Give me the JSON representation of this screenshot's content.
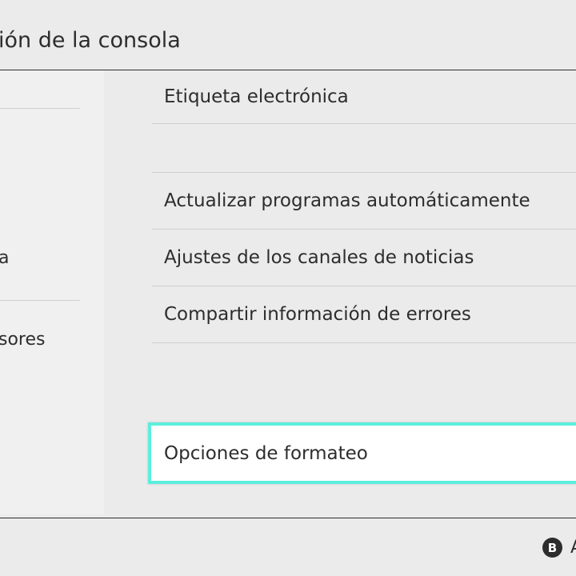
{
  "header": {
    "title": "ión de la consola"
  },
  "sidebar": {
    "items": [
      {
        "label": "a"
      },
      {
        "label": "sores"
      }
    ]
  },
  "menu": {
    "items": [
      {
        "label": "Etiqueta electrónica"
      },
      {
        "label": ""
      },
      {
        "label": "Actualizar programas automáticamente"
      },
      {
        "label": "Ajustes de los canales de noticias"
      },
      {
        "label": "Compartir información de errores"
      },
      {
        "label": "Opciones de formateo"
      }
    ]
  },
  "footer": {
    "button_icon": "B",
    "button_label": "A"
  },
  "colors": {
    "focus_border": "#5ceedc",
    "background": "#ebebeb",
    "text": "#2d2d2d"
  }
}
